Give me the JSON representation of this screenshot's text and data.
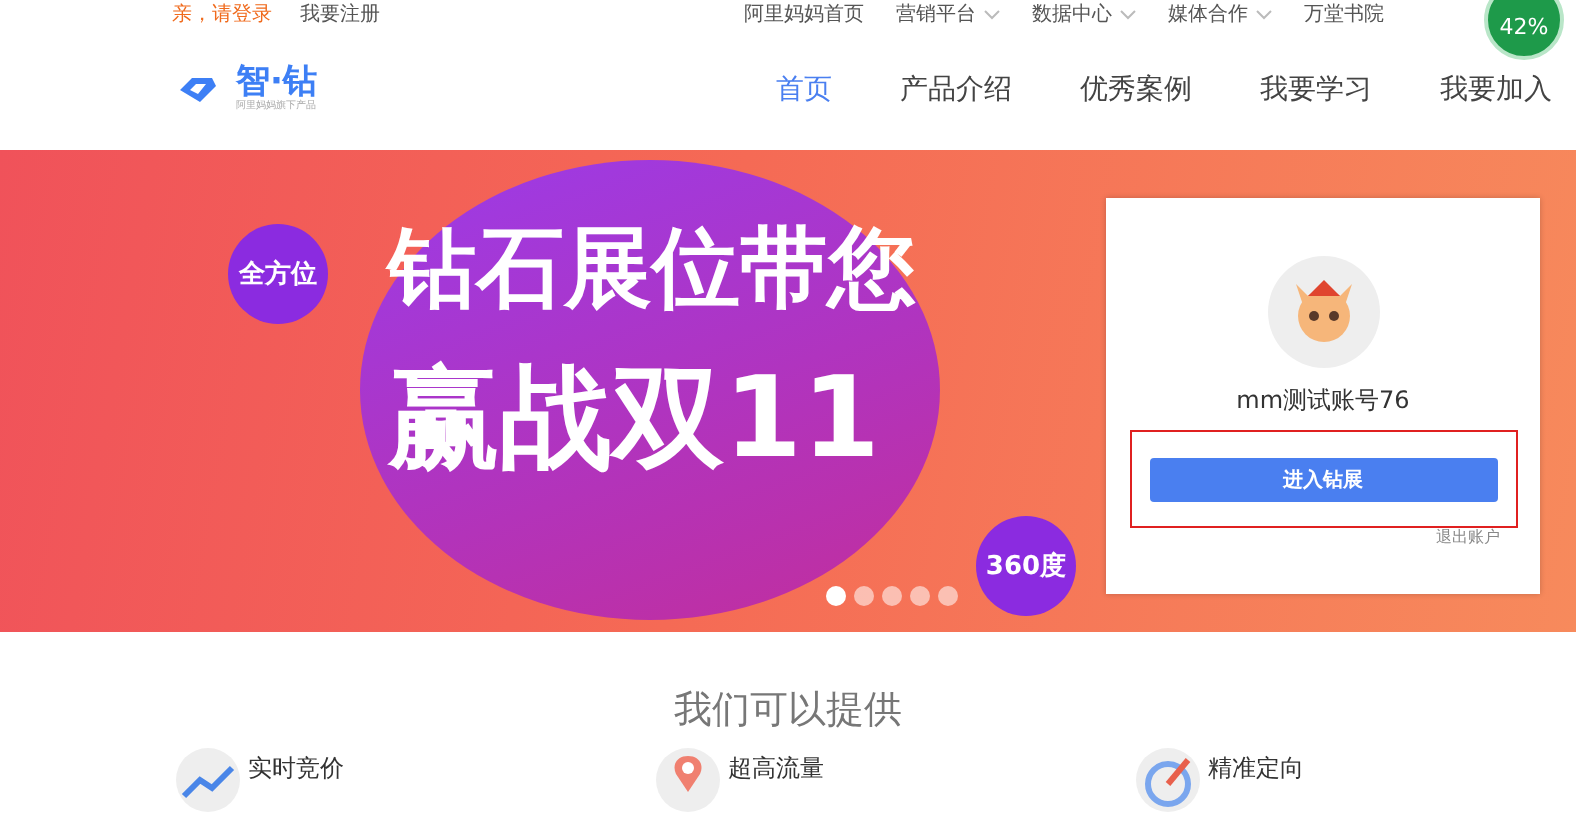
{
  "top_bar": {
    "login": "亲，请登录",
    "register": "我要注册",
    "links": [
      {
        "label": "阿里妈妈首页",
        "dropdown": false
      },
      {
        "label": "营销平台",
        "dropdown": true
      },
      {
        "label": "数据中心",
        "dropdown": true
      },
      {
        "label": "媒体合作",
        "dropdown": true
      },
      {
        "label": "万堂书院",
        "dropdown": false
      }
    ]
  },
  "badge": "42%",
  "header": {
    "logo": "智·钻",
    "logo_sub": "阿里妈妈旗下产品",
    "nav": [
      {
        "label": "首页",
        "selected": true
      },
      {
        "label": "产品介绍",
        "selected": false
      },
      {
        "label": "优秀案例",
        "selected": false
      },
      {
        "label": "我要学习",
        "selected": false
      },
      {
        "label": "我要加入",
        "selected": false
      }
    ]
  },
  "banner": {
    "tag_left": "全方位",
    "headline": [
      "钻石展位带您",
      "赢战双11"
    ],
    "tag_right": "360度",
    "dots": [
      {
        "selected": true
      },
      {
        "selected": false
      },
      {
        "selected": false
      },
      {
        "selected": false
      },
      {
        "selected": false
      }
    ]
  },
  "account": {
    "name": "mm测试账号76",
    "button": "进入钻展",
    "logout": "退出账户"
  },
  "offer": {
    "title": "我们可以提供",
    "features": [
      {
        "label": "实时竞价",
        "kind": "chart"
      },
      {
        "label": "超高流量",
        "kind": "pin"
      },
      {
        "label": "精准定向",
        "kind": "target"
      }
    ]
  }
}
